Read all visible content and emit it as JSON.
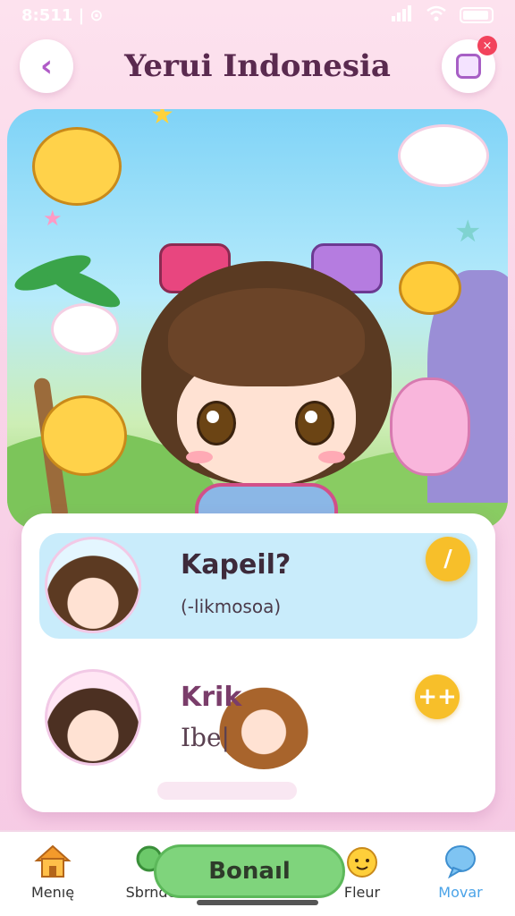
{
  "status_bar": {
    "time": "8:511 | ⊙",
    "icons": [
      "wifi-icon",
      "signal-icon",
      "battery-icon"
    ]
  },
  "header": {
    "title": "Yerui Indonesia",
    "back_icon": "chevron-left-icon",
    "profile_icon": "profile-card-icon",
    "notification_mark": "×"
  },
  "hero": {
    "image": "anime-girl-illustration"
  },
  "list": {
    "items": [
      {
        "title": "Kapeil?",
        "subtitle": "(-likmosoa)",
        "action_label": "/",
        "action_icon": "edit-icon"
      },
      {
        "title": "Krik",
        "subtitle": "Ibe|",
        "action_label": "++",
        "action_icon": "add-icon"
      }
    ]
  },
  "nav": {
    "items": [
      {
        "label": "Menıę",
        "icon": "home-icon"
      },
      {
        "label": "Sbrnde",
        "icon": "search-icon"
      },
      {
        "label": "Fleur",
        "icon": "mascot-icon"
      },
      {
        "label": "Movar",
        "icon": "chat-icon"
      }
    ],
    "center_button": "Bonaıl"
  },
  "colors": {
    "accent": "#b05bc7",
    "action": "#f7bf2a",
    "highlight": "#c9ecfb",
    "nav_active": "#4aa3e8",
    "center_button": "#7fd47c"
  }
}
